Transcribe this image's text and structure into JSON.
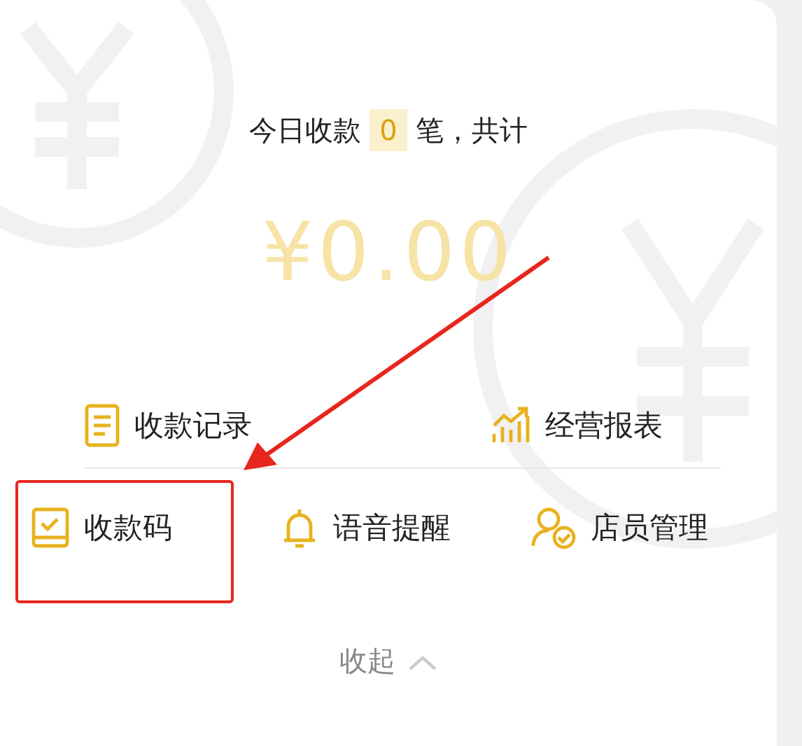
{
  "summary": {
    "prefix": "今日收款",
    "count": "0",
    "suffix": "笔，共计"
  },
  "amount": "¥0.00",
  "top_actions": [
    {
      "kind": "record",
      "label": "收款记录"
    },
    {
      "kind": "report",
      "label": "经营报表"
    }
  ],
  "bottom_actions": [
    {
      "kind": "qrcode",
      "label": "收款码",
      "highlighted": true
    },
    {
      "kind": "bell",
      "label": "语音提醒",
      "highlighted": false
    },
    {
      "kind": "staff",
      "label": "店员管理",
      "highlighted": false
    }
  ],
  "collapse": {
    "label": "收起"
  }
}
